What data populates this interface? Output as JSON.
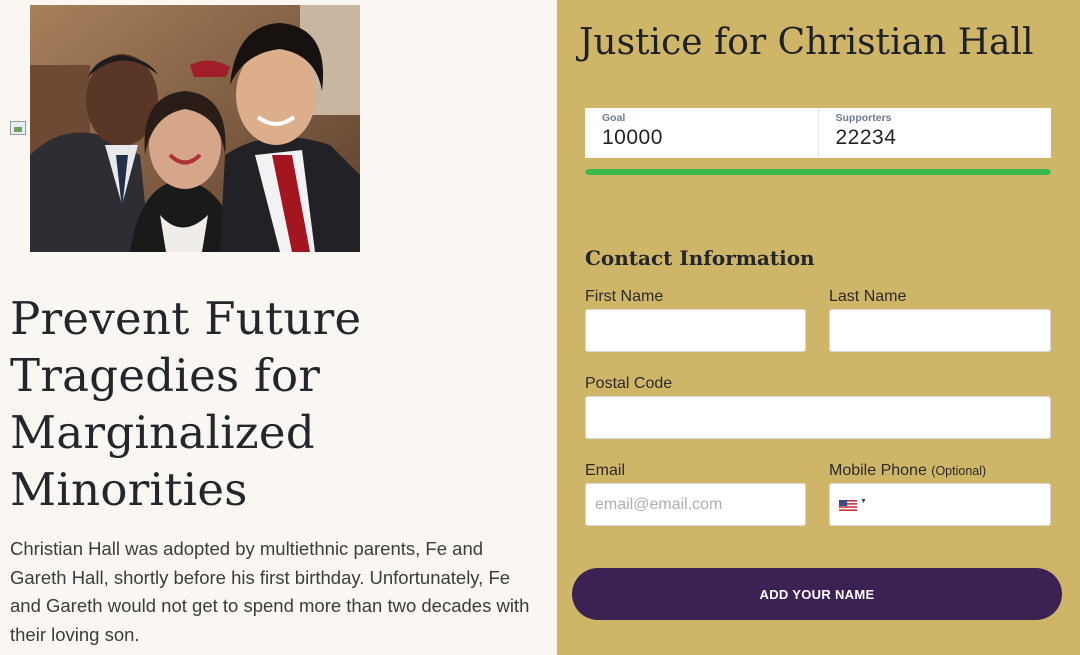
{
  "hero": {
    "photo_alt": "Christian Hall with his parents Fe and Gareth Hall",
    "headline": "Prevent Future Tragedies for Marginalized Minorities",
    "body": "Christian Hall was adopted by multiethnic parents, Fe and Gareth Hall, shortly before his first birthday. Unfortunately, Fe and Gareth would not get to spend more than two decades with their loving son."
  },
  "petition": {
    "title": "Justice for Christian Hall",
    "goal_label": "Goal",
    "goal_value": "10000",
    "supporters_label": "Supporters",
    "supporters_value": "22234",
    "progress_fraction": 1.0,
    "progress_color": "#3db84f"
  },
  "contact": {
    "section_title": "Contact Information",
    "first_name_label": "First Name",
    "first_name_value": "",
    "last_name_label": "Last Name",
    "last_name_value": "",
    "postal_code_label": "Postal Code",
    "postal_code_value": "",
    "email_label": "Email",
    "email_placeholder": "email@email.com",
    "mobile_label": "Mobile Phone",
    "mobile_optional": "(Optional)",
    "phone_country_icon": "us-flag-icon"
  },
  "submit_label": "ADD YOUR NAME",
  "colors": {
    "panel": "#cfb568",
    "button": "#3c2252",
    "page": "#faf7f3"
  }
}
